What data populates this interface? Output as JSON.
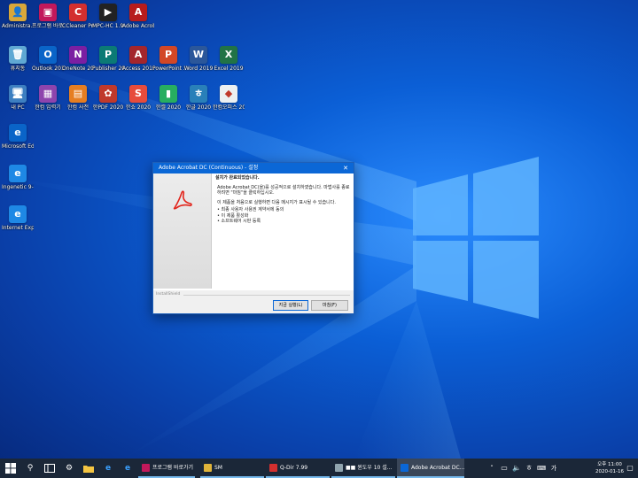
{
  "desktop": {
    "icons": [
      {
        "label": "Administra...",
        "glyph": "👤",
        "color": "#d8a73a"
      },
      {
        "label": "프로그램 바로가기",
        "glyph": "▣",
        "color": "#c2185b"
      },
      {
        "label": "CCleaner Pro 5.63",
        "glyph": "C",
        "color": "#d32f2f"
      },
      {
        "label": "MPC-HC 1.9.0",
        "glyph": "▶",
        "color": "#222222"
      },
      {
        "label": "Adobe Acrobat DC",
        "glyph": "A",
        "color": "#b71c1c"
      },
      {
        "label": "휴지통",
        "glyph": "🗑",
        "color": "#5fa8d3"
      },
      {
        "label": "Outlook 2019",
        "glyph": "O",
        "color": "#0a64c8"
      },
      {
        "label": "OneNote 2019",
        "glyph": "N",
        "color": "#7b1fa2"
      },
      {
        "label": "Publisher 2019",
        "glyph": "P",
        "color": "#0b7a75"
      },
      {
        "label": "Access 2019",
        "glyph": "A",
        "color": "#a4262c"
      },
      {
        "label": "PowerPoint 2019",
        "glyph": "P",
        "color": "#d24726"
      },
      {
        "label": "Word 2019",
        "glyph": "W",
        "color": "#2b579a"
      },
      {
        "label": "Excel 2019",
        "glyph": "X",
        "color": "#217346"
      },
      {
        "label": "내 PC",
        "glyph": "🖥",
        "color": "#3d7fc1"
      },
      {
        "label": "한컴 입력기",
        "glyph": "▦",
        "color": "#8e44ad"
      },
      {
        "label": "한컴 사전",
        "glyph": "▤",
        "color": "#e67e22"
      },
      {
        "label": "한PDF 2020",
        "glyph": "✿",
        "color": "#c0392b"
      },
      {
        "label": "한쇼 2020",
        "glyph": "S",
        "color": "#e74c3c"
      },
      {
        "label": "한셀 2020",
        "glyph": "▮",
        "color": "#27ae60"
      },
      {
        "label": "한글 2020",
        "glyph": "ㅎ",
        "color": "#2980b9"
      },
      {
        "label": "한컴오피스 2020",
        "glyph": "◆",
        "color": "#ecf0f1"
      },
      {
        "label": "Microsoft Edge",
        "glyph": "e",
        "color": "#0a64c8"
      },
      {
        "label": "Ingenetic 9-12",
        "glyph": "e",
        "color": "#1e88e5"
      },
      {
        "label": "Internet Explorer",
        "glyph": "e",
        "color": "#1e88e5"
      }
    ]
  },
  "dialog": {
    "title": "Adobe Acrobat DC (Continuous) - 설정",
    "close_glyph": "✕",
    "heading": "설치가 완료되었습니다.",
    "paragraph1": "Adobe Acrobat DC(을)를 성공적으로 설치하였습니다. 마법사를 종료하려면 \"마침\"을 클릭하십시오.",
    "paragraph2": "이 제품을 처음으로 실행하면 다음 메시지가 표시될 수 있습니다.",
    "bullets": [
      "• 최종 사용자 사용권 계약서에 동의",
      "• 이 제품 활성화",
      "• 소프트웨어 시판 등록"
    ],
    "installshield": "InstallShield",
    "launch_button": "지금 실행(L)",
    "finish_button": "마침(F)"
  },
  "taskbar": {
    "search_glyph": "⚲",
    "apps": [
      {
        "label": "프로그램 바로가기",
        "color": "#c2185b",
        "active": false
      },
      {
        "label": "SM",
        "color": "#e0b43a",
        "active": false
      },
      {
        "label": "Q-Dir 7.99",
        "color": "#d32f2f",
        "active": false
      },
      {
        "label": "■■ 윈도우 10 설...",
        "color": "#90a4ae",
        "active": false
      },
      {
        "label": "Adobe Acrobat DC...",
        "color": "#0b67d6",
        "active": true
      }
    ],
    "time": "오후 11:00",
    "date": "2020-01-16"
  }
}
